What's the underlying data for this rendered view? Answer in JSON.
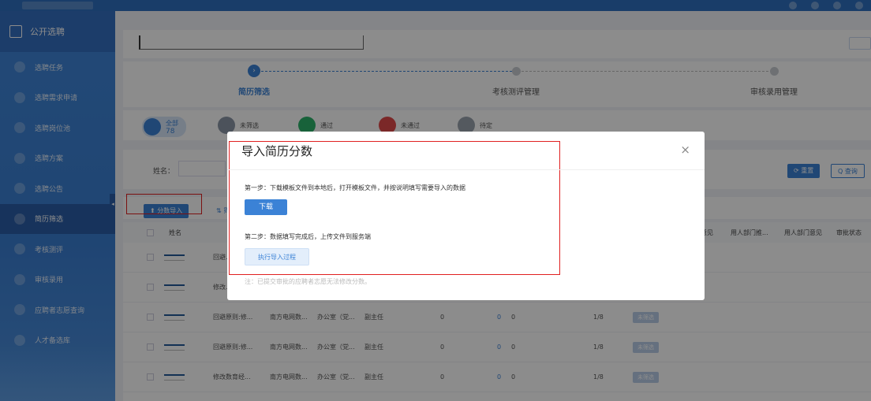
{
  "sidebar": {
    "header": "公开选聘",
    "items": [
      {
        "label": "选聘任务"
      },
      {
        "label": "选聘需求申请"
      },
      {
        "label": "选聘岗位池"
      },
      {
        "label": "选聘方案"
      },
      {
        "label": "选聘公告"
      },
      {
        "label": "简历筛选",
        "active": true
      },
      {
        "label": "考核测评"
      },
      {
        "label": "审核录用"
      },
      {
        "label": "应聘者志愿查询"
      },
      {
        "label": "人才备选库"
      }
    ]
  },
  "steps": [
    {
      "label": "简历筛选",
      "icon": "›",
      "state": "active"
    },
    {
      "label": "考核测评管理",
      "state": "pending"
    },
    {
      "label": "审核录用管理",
      "state": "pending"
    }
  ],
  "filters": [
    {
      "label": "全部",
      "count": "78"
    },
    {
      "label": "未筛选"
    },
    {
      "label": "通过"
    },
    {
      "label": "未通过"
    },
    {
      "label": "待定"
    }
  ],
  "search": {
    "name_label": "姓名："
  },
  "buttons": {
    "reset": "⟳ 重置",
    "query": "Q 查询",
    "import": "⬆ 分数导入",
    "other": "⇅ 筛"
  },
  "table": {
    "headers": [
      "姓名",
      "意见",
      "用人部门推...",
      "用人部门意见",
      "审批状态"
    ],
    "rows": [
      {
        "c1": "回避...",
        "c2": "",
        "c3": "",
        "c4": "",
        "c5": "",
        "c6": "",
        "c7": "",
        "c8": "",
        "tag": ""
      },
      {
        "c1": "修改...",
        "c2": "",
        "c3": "",
        "c4": "",
        "c5": "",
        "c6": "",
        "c7": "",
        "c8": "",
        "tag": ""
      },
      {
        "c1": "回避原则:修...",
        "c2": "南方电网数...",
        "c3": "办公室（党...",
        "c4": "副主任",
        "c5": "0",
        "c6": "0",
        "c7": "0",
        "c8": "1/8",
        "tag": "未筛选"
      },
      {
        "c1": "回避原则:修...",
        "c2": "南方电网数...",
        "c3": "办公室（党...",
        "c4": "副主任",
        "c5": "0",
        "c6": "0",
        "c7": "0",
        "c8": "1/8",
        "tag": "未筛选"
      },
      {
        "c1": "修改数育经...",
        "c2": "南方电网数...",
        "c3": "办公室（党...",
        "c4": "副主任",
        "c5": "0",
        "c6": "0",
        "c7": "0",
        "c8": "1/8",
        "tag": "未筛选"
      }
    ]
  },
  "modal": {
    "title": "导入简历分数",
    "close": "×",
    "step1_text": "第一步：下载模板文件到本地后，打开模板文件，并按说明填写需要导入的数据",
    "download_label": "下载",
    "step2_text": "第二步：数据填写完成后，上传文件到服务端",
    "run_label": "执行导入过程",
    "note": "注：已提交审批的应聘者志愿无法修改分数。"
  }
}
